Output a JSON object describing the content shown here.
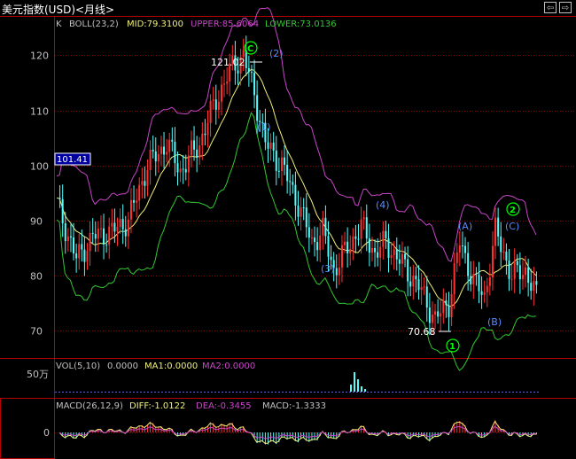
{
  "window": {
    "title": "美元指数(USD)<月线>",
    "nav_prev": "⇦",
    "nav_next": "⇨",
    "close": "×"
  },
  "main": {
    "indicator_prefix": "K",
    "indicator": "BOLL(23,2)",
    "mid_label": "MID:79.3100",
    "upper_label": "UPPER:85.6064",
    "lower_label": "LOWER:73.0136",
    "current_price_tag": "101.41",
    "high_annotation": "121.02",
    "low_annotation": "70.68",
    "y_axis": {
      "min": 65,
      "max": 127,
      "ticks": [
        "70",
        "80",
        "90",
        "100",
        "110",
        "120"
      ]
    },
    "wave_labels": [
      "C",
      "(2)",
      "(1)",
      "(3)",
      "(4)",
      "(A)",
      "(B)",
      "(C)",
      "2",
      "1"
    ]
  },
  "volume": {
    "label": "VOL(5,10)",
    "value": "0.0000",
    "ma1": "MA1:0.0000",
    "ma2": "MA2:0.0000",
    "axis_label": "50万"
  },
  "macd": {
    "label": "MACD(26,12,9)",
    "diff": "DIFF:-1.0122",
    "dea": "DEA:-0.3455",
    "macd_value": "MACD:-1.3333",
    "axis_zero": "0"
  },
  "colors": {
    "candle_up": "#ff3232",
    "candle_down": "#54fcfc",
    "mid": "#f0f07c",
    "upper": "#c846c8",
    "lower": "#32c832",
    "grid": "#8b0000",
    "frame": "#b40000",
    "annotation_green": "#00ff00",
    "annotation_blue": "#5a8cff"
  }
}
